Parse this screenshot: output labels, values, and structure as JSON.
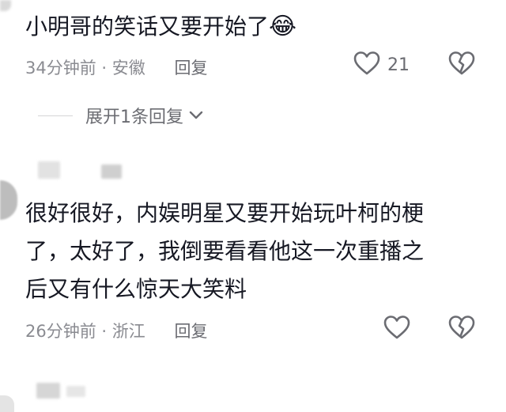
{
  "comment1": {
    "text": "小明哥的笑话又要开始了",
    "emoji": "😂",
    "time": "34分钟前",
    "separator": "·",
    "location": "安徽",
    "reply_label": "回复",
    "likes": "21"
  },
  "expand": {
    "label": "展开1条回复"
  },
  "comment2": {
    "lines": [
      "很好很好，内娱明星又要开始玩叶柯的梗",
      "了，太好了，我倒要看看他这一次重播之",
      "后又有什么惊天大笑料"
    ],
    "time": "26分钟前",
    "separator": "·",
    "location": "浙江",
    "reply_label": "回复"
  },
  "colors": {
    "text": "#161823",
    "meta": "#8a8b91",
    "icon": "#6b6c72"
  }
}
